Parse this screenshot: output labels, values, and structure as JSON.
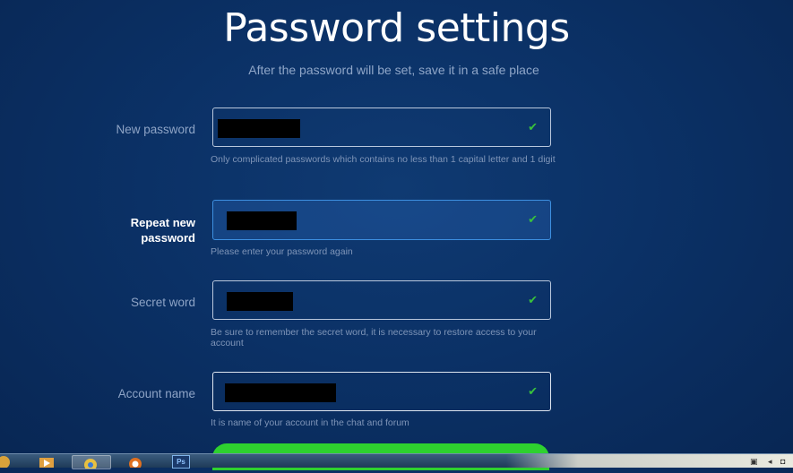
{
  "header": {
    "title": "Password settings",
    "subtitle": "After the password will be set, save it in a safe place"
  },
  "fields": [
    {
      "label": "New password",
      "hint": "Only complicated passwords which contains no less than 1 capital letter and 1 digit",
      "valid": true
    },
    {
      "label": "Repeat new password",
      "hint": "Please enter your password again",
      "valid": true
    },
    {
      "label": "Secret word",
      "hint": "Be sure to remember the secret word, it is necessary to restore access to your account",
      "valid": true
    },
    {
      "label": "Account name",
      "hint": "It is name of your account in the chat and forum",
      "valid": true
    }
  ],
  "icons": {
    "check": "check-icon"
  },
  "colors": {
    "accent_green": "#2ed12f",
    "check_green": "#39c13c",
    "background": "#0b3166"
  },
  "taskbar": {
    "ps_label": "Ps"
  }
}
